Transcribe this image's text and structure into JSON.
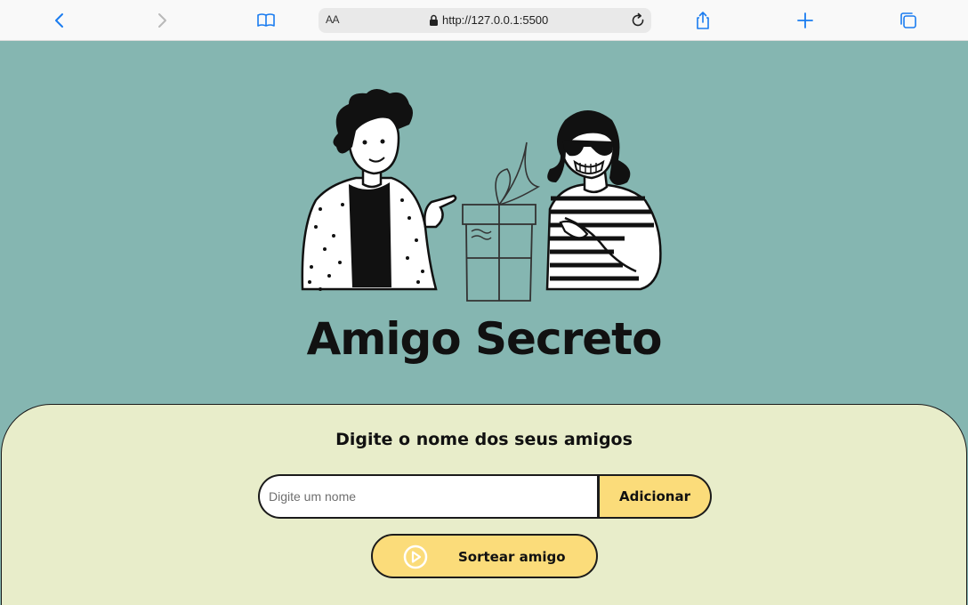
{
  "browser": {
    "text_size_label": "AA",
    "url": "http://127.0.0.1:5500",
    "icons": [
      "back-icon",
      "forward-icon",
      "reader-book-icon",
      "lock-icon",
      "reload-icon",
      "share-icon",
      "new-tab-plus-icon",
      "tabs-overview-icon"
    ],
    "accent_color": "#1a7cf0"
  },
  "hero": {
    "title": "Amigo Secreto",
    "illustration": "two-friends-with-gift-illustration"
  },
  "form": {
    "subtitle": "Digite o nome dos seus amigos",
    "input_placeholder": "Digite um nome",
    "input_value": "",
    "add_label": "Adicionar",
    "draw_label": "Sortear amigo",
    "draw_icon": "play-icon"
  },
  "colors": {
    "background": "#85b6b1",
    "panel": "#e8edca",
    "button": "#fbdc7a",
    "text": "#111111"
  }
}
